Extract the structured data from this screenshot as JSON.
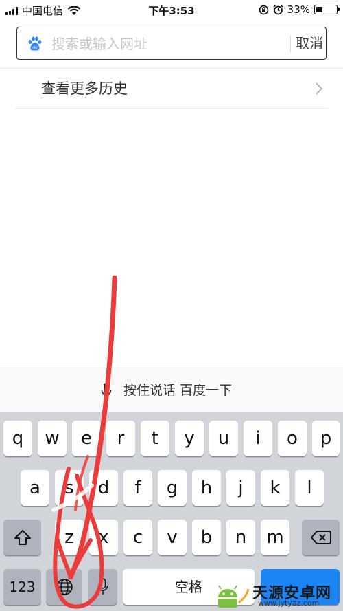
{
  "status_bar": {
    "carrier": "中国电信",
    "time": "下午3:53",
    "battery": "33%",
    "battery_level": 0.33
  },
  "search": {
    "placeholder": "搜索或输入网址",
    "value": "",
    "cancel_label": "取消",
    "icon": "baidu-paw-icon"
  },
  "history": {
    "more_label": "查看更多历史",
    "chevron_icon": "chevron-right-icon"
  },
  "voice_bar": {
    "label": "按住说话 百度一下",
    "icon": "microphone-icon"
  },
  "keyboard": {
    "row1": [
      "q",
      "w",
      "e",
      "r",
      "t",
      "y",
      "u",
      "i",
      "o",
      "p"
    ],
    "row2": [
      "a",
      "s",
      "d",
      "f",
      "g",
      "h",
      "j",
      "k",
      "l"
    ],
    "row3": [
      "z",
      "x",
      "c",
      "v",
      "b",
      "n",
      "m"
    ],
    "numbers_label": "123",
    "globe_icon": "globe-icon",
    "mic_icon": "microphone-icon",
    "shift_icon": "shift-icon",
    "delete_icon": "delete-icon",
    "space_label": "空格"
  },
  "watermark": {
    "title": "天源安卓网",
    "url": "www.jytyaz.com"
  },
  "colors": {
    "accent": "#3385ff",
    "annotation": "#ec3b3b",
    "keyboard_bg": "#d1d4d9",
    "function_key": "#aeb3bd"
  }
}
